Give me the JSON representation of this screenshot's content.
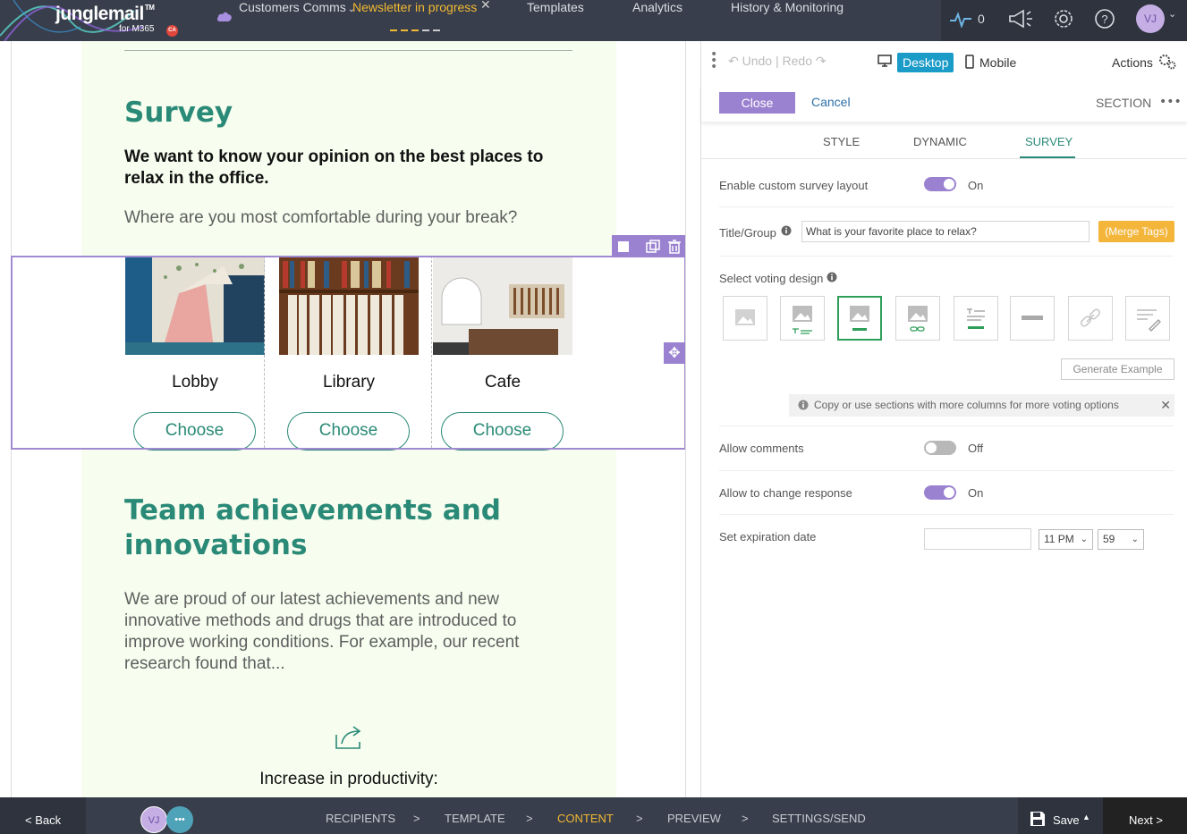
{
  "topbar": {
    "brand": "junglemail",
    "brand_tm": "TM",
    "brand_sub": "for M365",
    "brand_badge": "CA",
    "crumb_parent": "Customers Comms",
    "crumb_active": "Newsletter in progress",
    "close_glyph": "✕",
    "nav": [
      "Templates",
      "Analytics",
      "History & Monitoring"
    ],
    "activity_count": "0",
    "avatar_initials": "VJ"
  },
  "email": {
    "survey_heading": "Survey",
    "survey_question": "We want to know your opinion on the best places to relax in the office.",
    "survey_sub": "Where are you most comfortable during your break?",
    "options": [
      {
        "label": "Lobby",
        "button": "Choose"
      },
      {
        "label": "Library",
        "button": "Choose"
      },
      {
        "label": "Cafe",
        "button": "Choose"
      }
    ],
    "team_heading": "Team achievements and innovations",
    "team_text": "We are proud of our latest achievements and new innovative methods and drugs that are introduced to improve working conditions. For example, our recent research found that...",
    "increase_label": "Increase in productivity:"
  },
  "panel": {
    "undo_label": "Undo",
    "redo_label": "Redo",
    "undo_sep": "|",
    "desktop_label": "Desktop",
    "mobile_label": "Mobile",
    "actions_label": "Actions",
    "close_label": "Close",
    "cancel_label": "Cancel",
    "section_label": "SECTION",
    "tabs": [
      "STYLE",
      "DYNAMIC",
      "SURVEY"
    ],
    "enable_custom_label": "Enable custom survey layout",
    "enable_custom_state": "On",
    "title_group_label": "Title/Group",
    "title_group_value": "What is your favorite place to relax?",
    "merge_tags_label": "(Merge Tags)",
    "voting_design_label": "Select voting design",
    "generate_label": "Generate Example",
    "info_text": "Copy or use sections with more columns for more voting options",
    "allow_comments_label": "Allow comments",
    "allow_comments_state": "Off",
    "allow_change_label": "Allow to change response",
    "allow_change_state": "On",
    "expiration_label": "Set expiration date",
    "hour_value": "11 PM",
    "minute_value": "59"
  },
  "bottombar": {
    "back_label": "< Back",
    "avatar_initials": "VJ",
    "more_glyph": "•••",
    "steps": [
      "RECIPIENTS",
      "TEMPLATE",
      "CONTENT",
      "PREVIEW",
      "SETTINGS/SEND"
    ],
    "arrow": ">",
    "save_label": "Save",
    "next_label": "Next >"
  },
  "colors": {
    "accent_purple": "#9b82d0",
    "brand_green": "#2a8a77",
    "active_yellow": "#f2b933",
    "desktop_blue": "#1b9bc7"
  }
}
